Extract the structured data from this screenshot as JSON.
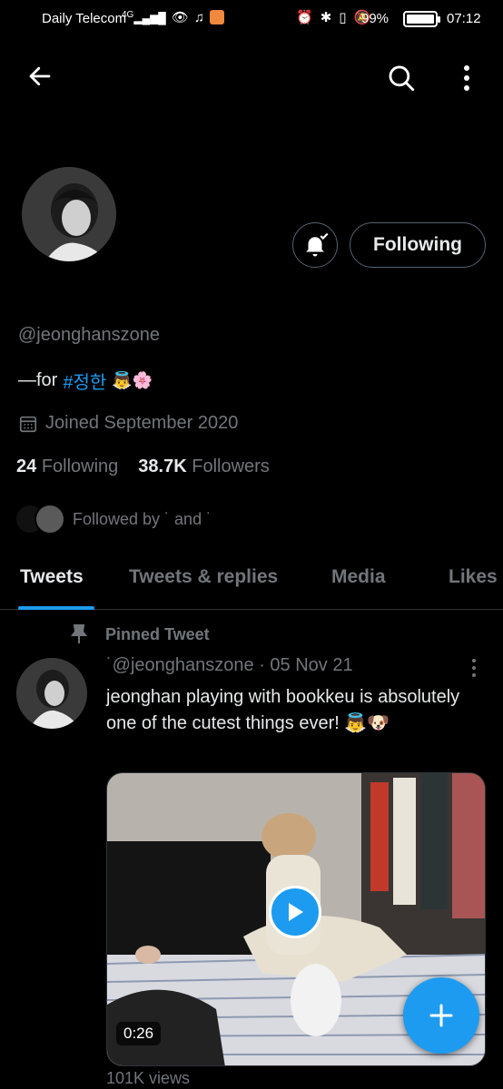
{
  "status_bar": {
    "carrier": "Daily Telecom",
    "network": "4G",
    "battery": "99%",
    "time": "07:12"
  },
  "profile": {
    "handle": "@jeonghanszone",
    "bio_prefix": "—for",
    "bio_hashtag": "#정한",
    "bio_emojis": "👼🌸",
    "joined": "Joined September 2020",
    "following_count": "24",
    "following_label": "Following",
    "followers_count": "38.7K",
    "followers_label": "Followers",
    "followed_by": "Followed by ˙ and ˙",
    "follow_button": "Following"
  },
  "tabs": [
    {
      "label": "Tweets",
      "active": true
    },
    {
      "label": "Tweets & replies",
      "active": false
    },
    {
      "label": "Media",
      "active": false
    },
    {
      "label": "Likes",
      "active": false
    }
  ],
  "tweet": {
    "pinned_label": "Pinned Tweet",
    "meta": "˙@jeonghanszone · 05 Nov 21",
    "text": "jeonghan playing with bookkeu is absolutely one of the cutest things ever! 👼🐶",
    "video_duration": "0:26",
    "views": "101K views"
  },
  "colors": {
    "accent": "#1d9bf0",
    "background": "#000000",
    "muted": "#71767b"
  },
  "icons": [
    "back-arrow-icon",
    "search-icon",
    "more-vertical-icon",
    "bell-icon",
    "calendar-icon",
    "pin-icon",
    "play-icon",
    "compose-plus-icon"
  ]
}
